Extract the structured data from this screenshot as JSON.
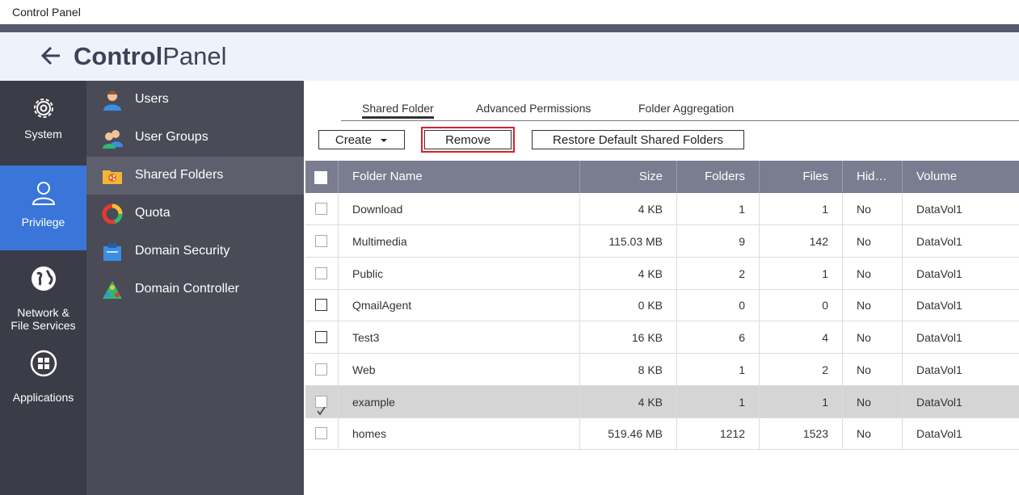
{
  "window": {
    "title": "Control Panel"
  },
  "app": {
    "title_bold": "Control",
    "title_light": "Panel"
  },
  "leftnav": [
    {
      "label_lines": [
        "System"
      ],
      "icon": "gear-icon"
    },
    {
      "label_lines": [
        "Privilege"
      ],
      "icon": "user-icon",
      "active": true
    },
    {
      "label_lines": [
        "Network &",
        "File Services"
      ],
      "icon": "globe-icon"
    },
    {
      "label_lines": [
        "Applications"
      ],
      "icon": "apps-grid-icon"
    }
  ],
  "subnav": [
    {
      "label": "Users",
      "icon": "users-icon"
    },
    {
      "label": "User Groups",
      "icon": "user-groups-icon"
    },
    {
      "label": "Shared Folders",
      "icon": "shared-folder-icon",
      "active": true
    },
    {
      "label": "Quota",
      "icon": "quota-pie-icon"
    },
    {
      "label": "Domain Security",
      "icon": "domain-security-icon"
    },
    {
      "label": "Domain Controller",
      "icon": "domain-controller-icon"
    }
  ],
  "tabs": [
    "Shared Folder",
    "Advanced Permissions",
    "Folder Aggregation"
  ],
  "toolbar": {
    "create": "Create",
    "remove": "Remove",
    "restore": "Restore Default Shared Folders"
  },
  "table": {
    "columns": [
      "Folder Name",
      "Size",
      "Folders",
      "Files",
      "Hid…",
      "Volume"
    ],
    "rows": [
      {
        "name": "Download",
        "size": "4 KB",
        "folders": "1",
        "files": "1",
        "hidden": "No",
        "volume": "DataVol1",
        "checked": false
      },
      {
        "name": "Multimedia",
        "size": "115.03 MB",
        "folders": "9",
        "files": "142",
        "hidden": "No",
        "volume": "DataVol1",
        "checked": false
      },
      {
        "name": "Public",
        "size": "4 KB",
        "folders": "2",
        "files": "1",
        "hidden": "No",
        "volume": "DataVol1",
        "checked": false
      },
      {
        "name": "QmailAgent",
        "size": "0 KB",
        "folders": "0",
        "files": "0",
        "hidden": "No",
        "volume": "DataVol1",
        "checked": false
      },
      {
        "name": "Test3",
        "size": "16 KB",
        "folders": "6",
        "files": "4",
        "hidden": "No",
        "volume": "DataVol1",
        "checked": false
      },
      {
        "name": "Web",
        "size": "8 KB",
        "folders": "1",
        "files": "2",
        "hidden": "No",
        "volume": "DataVol1",
        "checked": false
      },
      {
        "name": "example",
        "size": "4 KB",
        "folders": "1",
        "files": "1",
        "hidden": "No",
        "volume": "DataVol1",
        "checked": true
      },
      {
        "name": "homes",
        "size": "519.46 MB",
        "folders": "1212",
        "files": "1523",
        "hidden": "No",
        "volume": "DataVol1",
        "checked": false
      }
    ]
  },
  "colors": {
    "accent": "#3a76d9",
    "highlight_border": "#d8202a",
    "header": "#7a7d8f"
  }
}
